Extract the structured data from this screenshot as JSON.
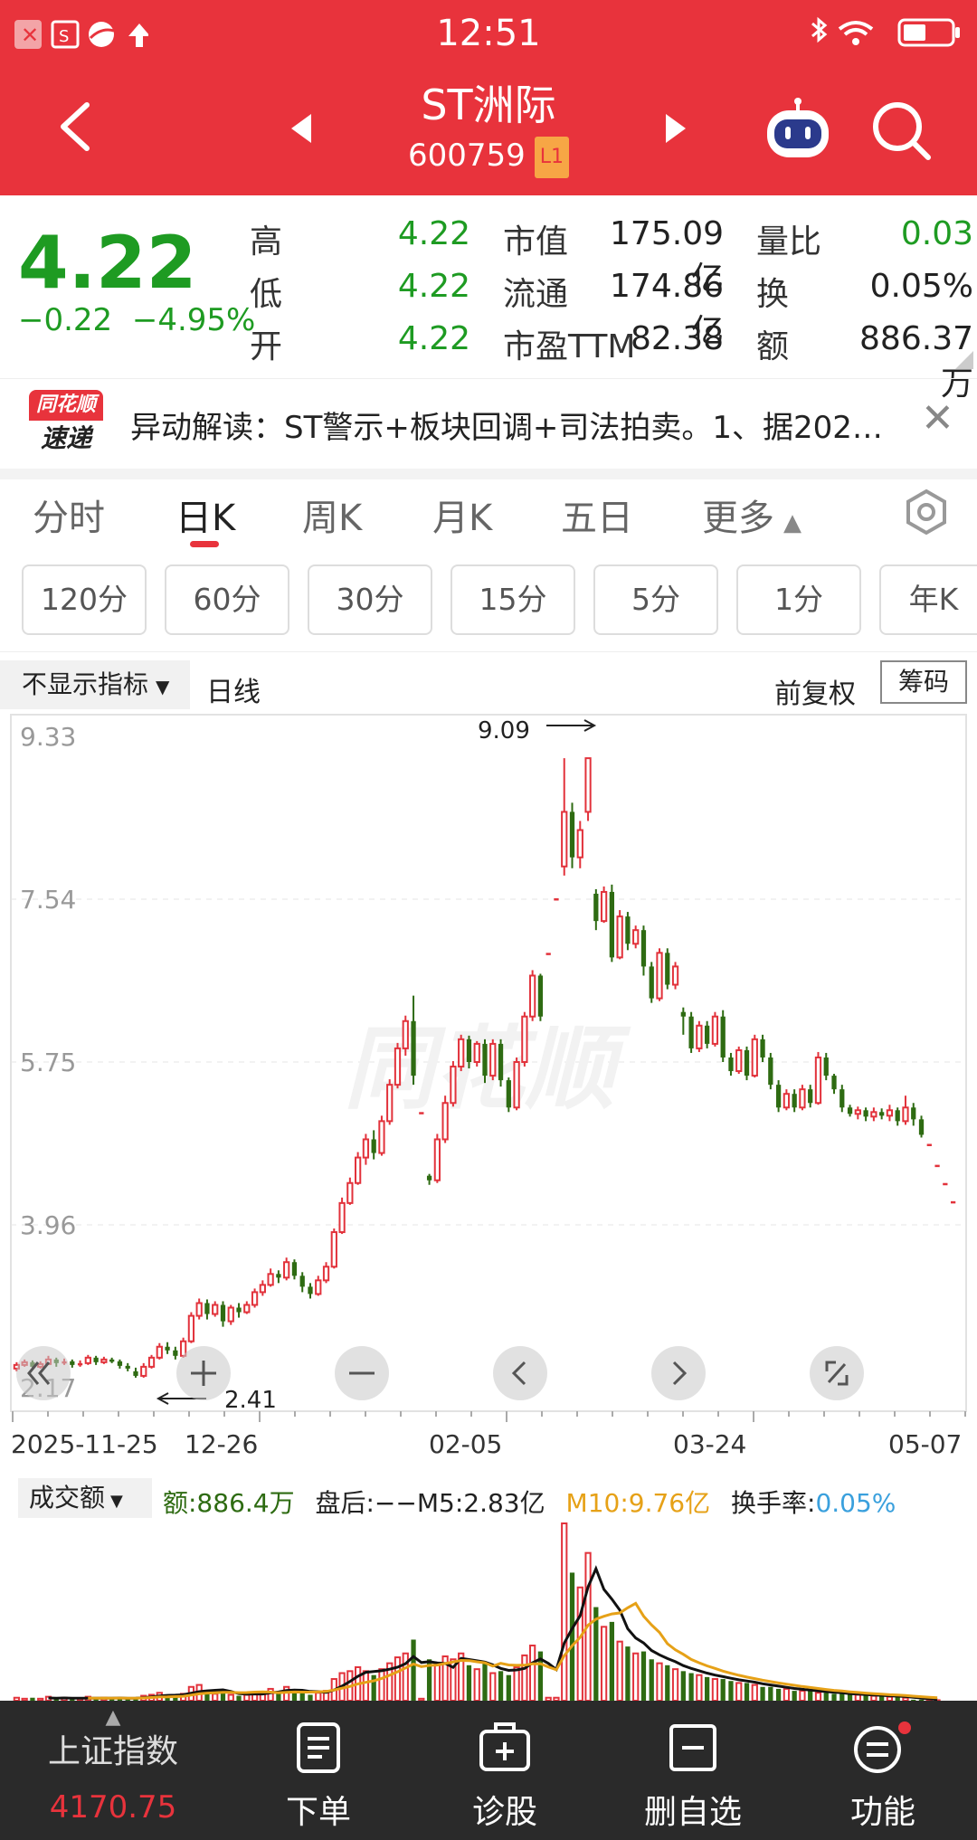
{
  "status_bar": {
    "time": "12:51"
  },
  "header": {
    "stock_name": "ST洲际",
    "stock_code": "600759",
    "level_badge": "L1"
  },
  "quote": {
    "price": "4.22",
    "change": "−0.22",
    "change_pct": "−4.95%",
    "high_label": "高",
    "high": "4.22",
    "low_label": "低",
    "low": "4.22",
    "open_label": "开",
    "open": "4.22",
    "mktcap_label": "市值",
    "mktcap": "175.09亿",
    "float_label": "流通",
    "float_cap": "174.86亿",
    "pe_label": "市盈TTM",
    "pe": "82.38",
    "vol_ratio_label": "量比",
    "vol_ratio": "0.03",
    "turnover_label": "换",
    "turnover": "0.05%",
    "amount_label": "额",
    "amount": "886.37万"
  },
  "news": {
    "logo_top": "同花顺",
    "logo_bottom": "速递",
    "text": "异动解读：ST警示+板块回调+司法拍卖。1、据202…"
  },
  "tabs": [
    "分时",
    "日K",
    "周K",
    "月K",
    "五日",
    "更多"
  ],
  "periods": [
    "120分",
    "60分",
    "30分",
    "15分",
    "5分",
    "1分",
    "年K"
  ],
  "chart_header": {
    "indicator": "不显示指标",
    "line_type": "日线",
    "adjust": "前复权",
    "chips_button": "筹码"
  },
  "chart_data": {
    "type": "candlestick",
    "y_ticks": [
      "9.33",
      "7.54",
      "5.75",
      "3.96",
      "2.17"
    ],
    "ylim": [
      2.17,
      9.33
    ],
    "x_ticks": [
      "2025-11-25",
      "12-26",
      "02-05",
      "03-24",
      "05-07"
    ],
    "max_marker": "9.09",
    "min_marker": "2.41",
    "watermark": "同花顺",
    "candles": [
      [
        2.38,
        2.42,
        2.35,
        2.45
      ],
      [
        2.42,
        2.45,
        2.4,
        2.48
      ],
      [
        2.45,
        2.4,
        2.37,
        2.47
      ],
      [
        2.4,
        2.43,
        2.38,
        2.46
      ],
      [
        2.43,
        2.48,
        2.42,
        2.52
      ],
      [
        2.48,
        2.44,
        2.4,
        2.5
      ],
      [
        2.44,
        2.46,
        2.42,
        2.49
      ],
      [
        2.46,
        2.42,
        2.39,
        2.48
      ],
      [
        2.42,
        2.44,
        2.4,
        2.47
      ],
      [
        2.44,
        2.5,
        2.42,
        2.53
      ],
      [
        2.5,
        2.45,
        2.42,
        2.52
      ],
      [
        2.45,
        2.48,
        2.43,
        2.51
      ],
      [
        2.48,
        2.46,
        2.44,
        2.5
      ],
      [
        2.46,
        2.41,
        2.38,
        2.48
      ],
      [
        2.41,
        2.38,
        2.35,
        2.44
      ],
      [
        2.35,
        2.3,
        2.28,
        2.39
      ],
      [
        2.3,
        2.4,
        2.28,
        2.44
      ],
      [
        2.4,
        2.5,
        2.38,
        2.53
      ],
      [
        2.5,
        2.62,
        2.48,
        2.66
      ],
      [
        2.62,
        2.58,
        2.54,
        2.67
      ],
      [
        2.58,
        2.52,
        2.48,
        2.62
      ],
      [
        2.52,
        2.68,
        2.5,
        2.72
      ],
      [
        2.68,
        2.96,
        2.66,
        3.0
      ],
      [
        2.96,
        3.1,
        2.92,
        3.15
      ],
      [
        3.1,
        2.98,
        2.92,
        3.14
      ],
      [
        2.98,
        3.08,
        2.95,
        3.12
      ],
      [
        3.08,
        2.9,
        2.84,
        3.12
      ],
      [
        2.9,
        3.05,
        2.86,
        3.08
      ],
      [
        3.05,
        3.0,
        2.94,
        3.1
      ],
      [
        3.0,
        3.08,
        2.98,
        3.12
      ],
      [
        3.08,
        3.22,
        3.05,
        3.26
      ],
      [
        3.22,
        3.3,
        3.18,
        3.35
      ],
      [
        3.3,
        3.42,
        3.28,
        3.48
      ],
      [
        3.42,
        3.38,
        3.32,
        3.46
      ],
      [
        3.38,
        3.55,
        3.35,
        3.6
      ],
      [
        3.55,
        3.4,
        3.36,
        3.58
      ],
      [
        3.4,
        3.28,
        3.22,
        3.44
      ],
      [
        3.28,
        3.2,
        3.15,
        3.32
      ],
      [
        3.2,
        3.35,
        3.18,
        3.4
      ],
      [
        3.35,
        3.5,
        3.32,
        3.55
      ],
      [
        3.5,
        3.88,
        3.48,
        3.92
      ],
      [
        3.88,
        4.2,
        3.86,
        4.26
      ],
      [
        4.2,
        4.42,
        4.18,
        4.48
      ],
      [
        4.42,
        4.7,
        4.4,
        4.76
      ],
      [
        4.7,
        4.9,
        4.62,
        4.96
      ],
      [
        4.9,
        4.75,
        4.68,
        5.0
      ],
      [
        4.75,
        5.1,
        4.72,
        5.16
      ],
      [
        5.1,
        5.5,
        5.06,
        5.56
      ],
      [
        5.5,
        5.9,
        5.46,
        5.96
      ],
      [
        5.9,
        6.2,
        5.82,
        6.26
      ],
      [
        6.2,
        5.6,
        5.5,
        6.48
      ],
      [
        5.2,
        5.2,
        5.2,
        5.2
      ],
      [
        4.5,
        4.45,
        4.4,
        4.52
      ],
      [
        4.45,
        4.9,
        4.42,
        4.96
      ],
      [
        4.9,
        5.3,
        4.86,
        5.38
      ],
      [
        5.3,
        5.7,
        5.26,
        5.76
      ],
      [
        5.7,
        6.0,
        5.65,
        6.05
      ],
      [
        6.0,
        5.75,
        5.68,
        6.04
      ],
      [
        5.75,
        5.95,
        5.7,
        5.98
      ],
      [
        5.95,
        5.6,
        5.52,
        6.0
      ],
      [
        5.6,
        5.95,
        5.55,
        6.0
      ],
      [
        5.95,
        5.55,
        5.48,
        6.0
      ],
      [
        5.55,
        5.25,
        5.2,
        5.58
      ],
      [
        5.25,
        5.75,
        5.22,
        5.8
      ],
      [
        5.75,
        6.25,
        5.7,
        6.3
      ],
      [
        6.25,
        6.7,
        6.2,
        6.76
      ],
      [
        6.7,
        6.25,
        6.2,
        6.72
      ],
      [
        6.95,
        6.95,
        6.95,
        6.95
      ],
      [
        7.55,
        7.55,
        7.55,
        7.55
      ],
      [
        7.9,
        8.5,
        7.8,
        9.09
      ],
      [
        8.5,
        8.0,
        7.88,
        8.6
      ],
      [
        8.0,
        8.3,
        7.88,
        8.4
      ],
      [
        8.5,
        9.09,
        8.4,
        9.09
      ],
      [
        7.6,
        7.3,
        7.2,
        7.65
      ],
      [
        7.3,
        7.62,
        7.28,
        7.68
      ],
      [
        7.62,
        6.9,
        6.85,
        7.7
      ],
      [
        6.9,
        7.35,
        6.88,
        7.42
      ],
      [
        7.35,
        7.05,
        6.98,
        7.4
      ],
      [
        7.05,
        7.2,
        7.0,
        7.25
      ],
      [
        7.2,
        6.8,
        6.7,
        7.25
      ],
      [
        6.8,
        6.45,
        6.4,
        6.85
      ],
      [
        6.45,
        6.95,
        6.42,
        7.0
      ],
      [
        6.95,
        6.6,
        6.55,
        7.0
      ],
      [
        6.6,
        6.8,
        6.55,
        6.85
      ],
      [
        6.3,
        6.25,
        6.05,
        6.35
      ],
      [
        6.25,
        5.9,
        5.85,
        6.3
      ],
      [
        5.9,
        6.15,
        5.86,
        6.2
      ],
      [
        6.15,
        5.95,
        5.9,
        6.2
      ],
      [
        5.95,
        6.25,
        5.92,
        6.3
      ],
      [
        6.25,
        5.8,
        5.75,
        6.32
      ],
      [
        5.8,
        5.65,
        5.6,
        5.85
      ],
      [
        5.65,
        5.88,
        5.62,
        5.92
      ],
      [
        5.88,
        5.6,
        5.55,
        5.92
      ],
      [
        5.6,
        6.0,
        5.58,
        6.05
      ],
      [
        6.0,
        5.8,
        5.75,
        6.05
      ],
      [
        5.8,
        5.5,
        5.45,
        5.85
      ],
      [
        5.5,
        5.25,
        5.2,
        5.55
      ],
      [
        5.25,
        5.4,
        5.22,
        5.45
      ],
      [
        5.4,
        5.25,
        5.2,
        5.45
      ],
      [
        5.25,
        5.45,
        5.22,
        5.5
      ],
      [
        5.45,
        5.3,
        5.25,
        5.5
      ],
      [
        5.3,
        5.8,
        5.28,
        5.86
      ],
      [
        5.8,
        5.6,
        5.55,
        5.85
      ],
      [
        5.6,
        5.45,
        5.4,
        5.62
      ],
      [
        5.45,
        5.25,
        5.2,
        5.5
      ],
      [
        5.25,
        5.18,
        5.15,
        5.28
      ],
      [
        5.18,
        5.22,
        5.12,
        5.26
      ],
      [
        5.22,
        5.15,
        5.1,
        5.25
      ],
      [
        5.15,
        5.2,
        5.1,
        5.25
      ],
      [
        5.2,
        5.16,
        5.12,
        5.24
      ],
      [
        5.16,
        5.22,
        5.1,
        5.28
      ],
      [
        5.22,
        5.1,
        5.05,
        5.25
      ],
      [
        5.1,
        5.25,
        5.06,
        5.38
      ],
      [
        5.25,
        5.12,
        5.05,
        5.3
      ],
      [
        5.12,
        4.95,
        4.92,
        5.16
      ],
      [
        4.85,
        4.85,
        4.85,
        4.85
      ],
      [
        4.62,
        4.62,
        4.62,
        4.62
      ],
      [
        4.42,
        4.42,
        4.42,
        4.42
      ],
      [
        4.22,
        4.22,
        4.22,
        4.22
      ]
    ],
    "volume_legend": {
      "label": "成交额",
      "amount": "额:886.4万",
      "after_hours": "盘后:−−",
      "m5": "M5:2.83亿",
      "m10": "M10:9.76亿",
      "turnover_label": "换手率:",
      "turnover": "0.05%"
    },
    "volumes": [
      0.3,
      0.2,
      0.3,
      0.2,
      0.4,
      0.2,
      0.3,
      0.2,
      0.2,
      0.4,
      0.2,
      0.3,
      0.2,
      0.3,
      0.2,
      0.3,
      0.5,
      0.6,
      0.8,
      0.5,
      0.4,
      0.7,
      1.4,
      1.6,
      0.9,
      0.7,
      0.9,
      0.6,
      0.5,
      0.6,
      0.8,
      0.9,
      1.2,
      0.9,
      1.4,
      1.0,
      0.8,
      0.6,
      0.8,
      1.0,
      2.2,
      2.8,
      3.0,
      3.4,
      3.0,
      2.6,
      3.2,
      3.8,
      4.4,
      4.8,
      6.2,
      0.2,
      4.2,
      3.8,
      4.5,
      4.2,
      4.8,
      3.6,
      3.2,
      3.8,
      2.8,
      3.0,
      2.6,
      3.4,
      4.6,
      5.6,
      5.0,
      0.3,
      0.3,
      18.0,
      13.0,
      11.5,
      15.0,
      9.5,
      7.5,
      8.0,
      6.0,
      5.5,
      4.8,
      5.0,
      4.2,
      3.8,
      3.6,
      3.2,
      3.0,
      2.8,
      2.6,
      2.4,
      2.2,
      2.2,
      2.0,
      1.8,
      1.8,
      1.6,
      1.4,
      1.4,
      1.2,
      1.2,
      1.0,
      1.0,
      1.0,
      0.8,
      0.8,
      0.7,
      0.7,
      0.6,
      0.6,
      0.5,
      0.5,
      0.5,
      0.4,
      0.4,
      0.3,
      0.1,
      0.1,
      0.05,
      0.05
    ]
  },
  "bottom_nav": {
    "index_name": "上证指数",
    "index_value": "4170.75",
    "items": [
      "下单",
      "诊股",
      "删自选",
      "功能"
    ]
  }
}
